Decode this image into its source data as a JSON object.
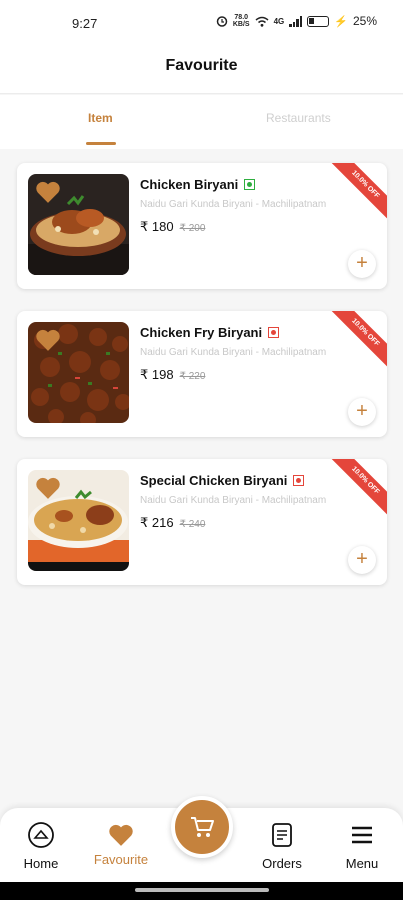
{
  "status_bar": {
    "time": "9:27",
    "net_speed_value": "78.0",
    "net_speed_unit": "KB/S",
    "network_type": "4G",
    "battery": "25%"
  },
  "header": {
    "title": "Favourite"
  },
  "tabs": [
    {
      "label": "Item",
      "active": true
    },
    {
      "label": "Restaurants",
      "active": false
    }
  ],
  "favourites": [
    {
      "name": "Chicken Biryani",
      "diet": "veg",
      "restaurant": "Naidu Gari Kunda Biryani - Machilipatnam",
      "price": "₹ 180",
      "original_price": "₹ 200",
      "discount": "10.0% OFF"
    },
    {
      "name": "Chicken Fry Biryani",
      "diet": "non-veg",
      "restaurant": "Naidu Gari Kunda Biryani - Machilipatnam",
      "price": "₹ 198",
      "original_price": "₹ 220",
      "discount": "10.0% OFF"
    },
    {
      "name": "Special Chicken Biryani",
      "diet": "non-veg",
      "restaurant": "Naidu Gari Kunda Biryani - Machilipatnam",
      "price": "₹ 216",
      "original_price": "₹ 240",
      "discount": "10.0% OFF"
    }
  ],
  "bottom_nav": {
    "home": "Home",
    "favourite": "Favourite",
    "orders": "Orders",
    "menu": "Menu"
  },
  "icons": {
    "favourite": "heart-icon",
    "add": "plus-icon",
    "cart": "cart-icon",
    "home": "home-icon",
    "orders": "orders-icon",
    "menu": "hamburger-icon"
  },
  "colors": {
    "accent": "#c5823d",
    "discount_ribbon": "#e4463b",
    "veg": "#2eae3f",
    "non_veg": "#e4463b"
  }
}
